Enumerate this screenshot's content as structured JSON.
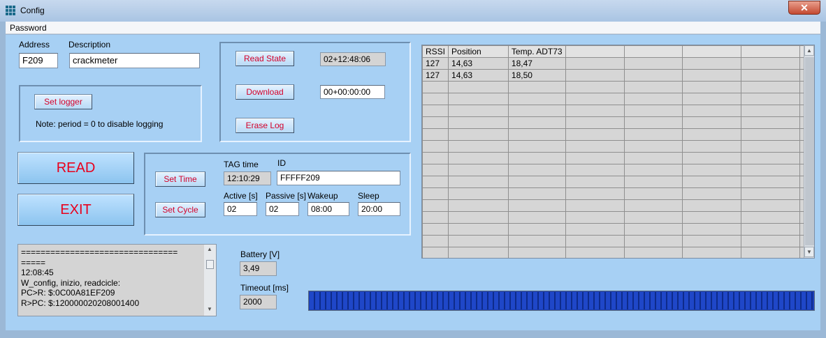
{
  "window": {
    "title": "Config",
    "close_glyph": "✕"
  },
  "menu": {
    "password": "Password"
  },
  "device": {
    "address_label": "Address",
    "address_value": "F209",
    "description_label": "Description",
    "description_value": "crackmeter"
  },
  "logger": {
    "set_logger": "Set logger",
    "note": "Note: period = 0 to disable logging"
  },
  "state": {
    "read_state": "Read State",
    "read_state_value": "02+12:48:06",
    "download": "Download",
    "download_value": "00+00:00:00",
    "erase_log": "Erase Log"
  },
  "actions": {
    "read": "READ",
    "exit": "EXIT"
  },
  "tag": {
    "set_time": "Set Time",
    "set_cycle": "Set Cycle",
    "tag_time_label": "TAG time",
    "tag_time_value": "12:10:29",
    "id_label": "ID",
    "id_value": "FFFFF209",
    "active_label": "Active [s]",
    "active_value": "02",
    "passive_label": "Passive [s]",
    "passive_value": "02",
    "wakeup_label": "Wakeup",
    "wakeup_value": "08:00",
    "sleep_label": "Sleep",
    "sleep_value": "20:00"
  },
  "table": {
    "columns": [
      "RSSI",
      "Position",
      "Temp. ADT73",
      "",
      "",
      "",
      "",
      ""
    ],
    "rows": [
      [
        "127",
        "14,63",
        "18,47",
        "",
        "",
        "",
        "",
        ""
      ],
      [
        "127",
        "14,63",
        "18,50",
        "",
        "",
        "",
        "",
        ""
      ]
    ],
    "empty_rows": 15
  },
  "log": {
    "lines": [
      "================================",
      "=====",
      "12:08:45",
      "W_config, inizio, readcicle:",
      "PC>R: $:0C00A81EF209",
      "R>PC: $:120000020208001400"
    ]
  },
  "status": {
    "battery_label": "Battery [V]",
    "battery_value": "3,49",
    "timeout_label": "Timeout [ms]",
    "timeout_value": "2000"
  },
  "progress": {
    "fraction": 1.0
  },
  "colors": {
    "button_text": "#d4002a",
    "panel_bg": "#a7d0f4",
    "progress": "#1f47c8"
  },
  "icons": {
    "app": "grid-app-icon",
    "scroll_up": "▲",
    "scroll_down": "▼"
  }
}
